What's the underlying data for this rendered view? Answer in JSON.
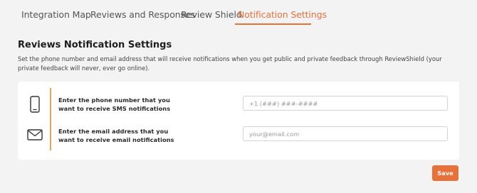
{
  "tabs": [
    {
      "label": "Integration Map",
      "active": false
    },
    {
      "label": "Reviews and Responses",
      "active": false
    },
    {
      "label": "Review Shield",
      "active": false
    },
    {
      "label": "Notification Settings",
      "active": true
    }
  ],
  "section": {
    "title": "Reviews Notification Settings",
    "description": "Set the phone number and email address that will receive notifications when you get public and private feedback through ReviewShield (your private feedback will never, ever go online)."
  },
  "phone_row": {
    "icon": "smartphone-icon",
    "label": "Enter the phone number that you want to receive SMS notifications",
    "placeholder": "+1 (###) ###-####",
    "value": ""
  },
  "email_row": {
    "icon": "envelope-icon",
    "label": "Enter the email address that you want to receive email notifications",
    "placeholder": "your@email.com",
    "value": ""
  },
  "save_label": "Save",
  "colors": {
    "accent": "#e8703a",
    "divider_accent": "#e8a35d",
    "background": "#f3f3f3",
    "card": "#ffffff"
  }
}
